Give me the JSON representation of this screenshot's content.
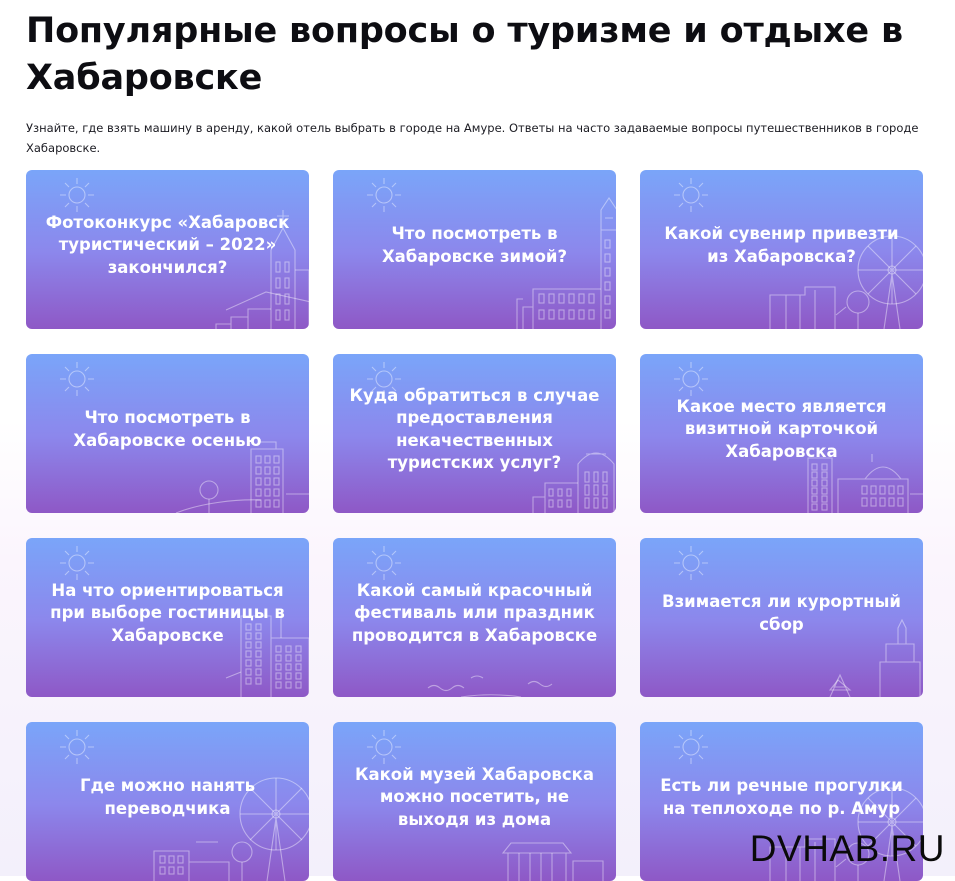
{
  "page": {
    "title": "Популярные вопросы о туризме и отдыхе в Хабаровске",
    "intro": "Узнайте, где взять машину в аренду, какой отель выбрать в городе на Амуре. Ответы на часто задаваемые вопросы путешественников в городе Хабаровске."
  },
  "cards": [
    {
      "title": "Фотоконкурс «Хабаровск туристический – 2022» закончился?",
      "art": "tower"
    },
    {
      "title": "Что посмотреть в Хабаровске зимой?",
      "art": "church"
    },
    {
      "title": "Какой сувенир привезти из Хабаровска?",
      "art": "wheel"
    },
    {
      "title": "Что посмотреть в Хабаровске осенью",
      "art": "building-tree"
    },
    {
      "title": "Куда обратиться в случае предоставления некачественных туристских услуг?",
      "art": "station"
    },
    {
      "title": "Какое место является визитной карточкой Хабаровска",
      "art": "dome"
    },
    {
      "title": "На что ориентироваться при выборе гостиницы в Хабаровске",
      "art": "hotel"
    },
    {
      "title": "Какой самый красочный фестиваль или праздник проводится в Хабаровске",
      "art": "river"
    },
    {
      "title": "Взимается ли курортный сбор",
      "art": "monument"
    },
    {
      "title": "Где можно нанять переводчика",
      "art": "wheel-left"
    },
    {
      "title": "Какой музей Хабаровска можно посетить, не выходя из дома",
      "art": "museum"
    },
    {
      "title": "Есть ли речные прогулки на теплоходе по р. Амур",
      "art": "wheel"
    }
  ],
  "watermark": "DVHAB.RU"
}
